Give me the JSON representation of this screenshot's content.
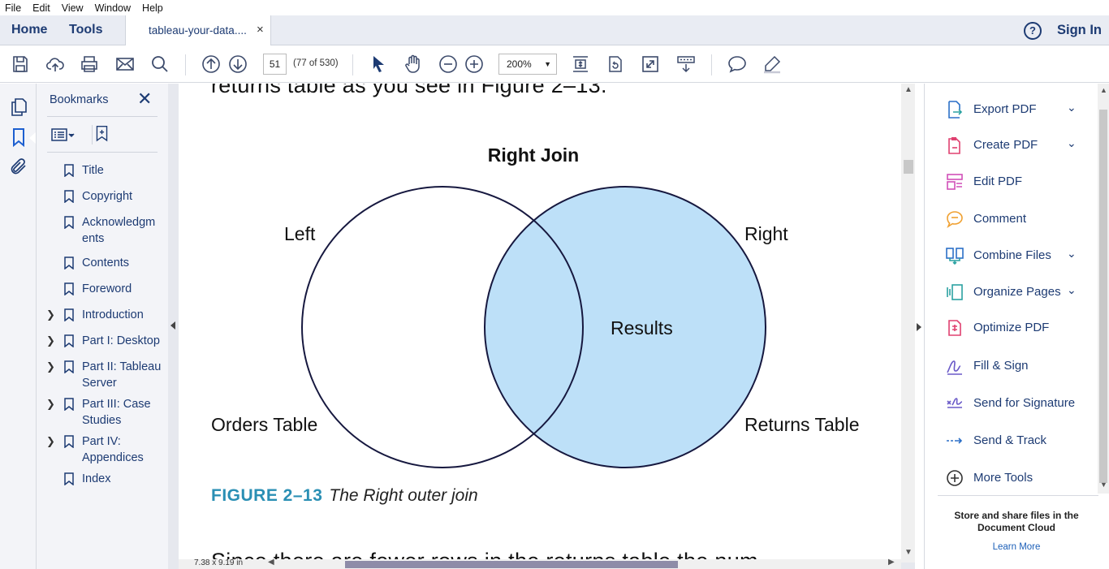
{
  "menu": [
    "File",
    "Edit",
    "View",
    "Window",
    "Help"
  ],
  "tabs": {
    "home": "Home",
    "tools": "Tools",
    "document": "tableau-your-data....",
    "close": "×",
    "help": "?",
    "signin": "Sign In"
  },
  "toolbar": {
    "page_number": "51",
    "page_of": "(77 of 530)",
    "zoom": "200%"
  },
  "bookmarks": {
    "title": "Bookmarks",
    "close": "✕",
    "items": [
      {
        "label": "Title",
        "expandable": false
      },
      {
        "label": "Copyright",
        "expandable": false
      },
      {
        "label": "Acknowledgm ents",
        "expandable": false
      },
      {
        "label": "Contents",
        "expandable": false
      },
      {
        "label": "Foreword",
        "expandable": false
      },
      {
        "label": "Introduction",
        "expandable": true
      },
      {
        "label": "Part I: Desktop",
        "expandable": true
      },
      {
        "label": "Part II: Tableau Server",
        "expandable": true
      },
      {
        "label": "Part III: Case Studies",
        "expandable": true
      },
      {
        "label": "Part IV: Appendices",
        "expandable": true
      },
      {
        "label": "Index",
        "expandable": false
      }
    ]
  },
  "document": {
    "top_text": "returns table as you see in Figure 2–13.",
    "bottom_text": "Since there are fewer rows in the returns table the num",
    "figure": {
      "title": "Right Join",
      "left_label": "Left",
      "right_label": "Right",
      "center_label": "Results",
      "left_table": "Orders Table",
      "right_table": "Returns Table",
      "caption_number": "FIGURE 2–13",
      "caption_text": "The Right outer join",
      "fill_color": "#bde0f8",
      "stroke_color": "#16183f"
    },
    "page_size": "7.38 x 9.19 in"
  },
  "tools": [
    {
      "label": "Export PDF",
      "icon": "export-pdf-icon",
      "expandable": true
    },
    {
      "label": "Create PDF",
      "icon": "create-pdf-icon",
      "expandable": true
    },
    {
      "label": "Edit PDF",
      "icon": "edit-pdf-icon",
      "expandable": false
    },
    {
      "label": "Comment",
      "icon": "comment-icon",
      "expandable": false
    },
    {
      "label": "Combine Files",
      "icon": "combine-files-icon",
      "expandable": true
    },
    {
      "label": "Organize Pages",
      "icon": "organize-pages-icon",
      "expandable": true
    },
    {
      "label": "Optimize PDF",
      "icon": "optimize-pdf-icon",
      "expandable": false
    },
    {
      "label": "Fill & Sign",
      "icon": "fill-sign-icon",
      "expandable": false
    },
    {
      "label": "Send for Signature",
      "icon": "send-signature-icon",
      "expandable": false
    },
    {
      "label": "Send & Track",
      "icon": "send-track-icon",
      "expandable": false
    },
    {
      "label": "More Tools",
      "icon": "more-tools-icon",
      "expandable": false
    }
  ],
  "cloud": {
    "text": "Store and share files in the Document Cloud",
    "link": "Learn More"
  }
}
